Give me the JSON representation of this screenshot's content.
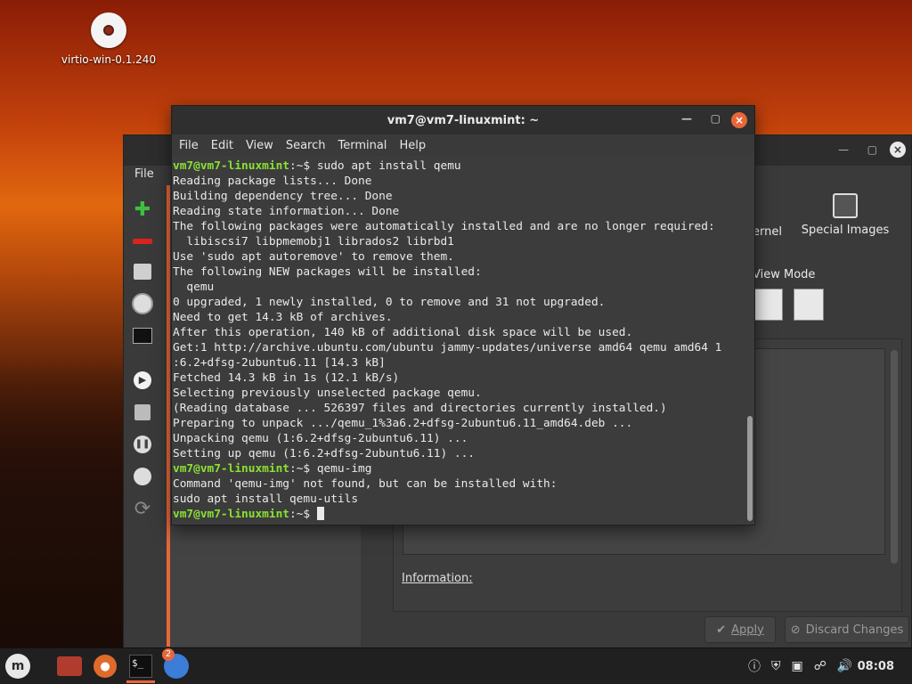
{
  "desktop": {
    "icon_label": "virtio-win-0.1.240"
  },
  "virt_window": {
    "menu_file": "File",
    "kernel_label": "ernel",
    "special_images_label": "Special Images",
    "view_mode_label": "View Mode",
    "information_label": "Information:",
    "apply_label": "Apply",
    "discard_label": "Discard Changes"
  },
  "terminal": {
    "title": "vm7@vm7-linuxmint: ~",
    "menu": [
      "File",
      "Edit",
      "View",
      "Search",
      "Terminal",
      "Help"
    ],
    "lines": [
      {
        "prompt": "vm7@vm7-linuxmint",
        "path": ":~$ ",
        "text": "sudo apt install qemu"
      },
      {
        "text": "Reading package lists... Done"
      },
      {
        "text": "Building dependency tree... Done"
      },
      {
        "text": "Reading state information... Done"
      },
      {
        "text": "The following packages were automatically installed and are no longer required:"
      },
      {
        "text": "  libiscsi7 libpmemobj1 librados2 librbd1"
      },
      {
        "text": "Use 'sudo apt autoremove' to remove them."
      },
      {
        "text": "The following NEW packages will be installed:"
      },
      {
        "text": "  qemu"
      },
      {
        "text": "0 upgraded, 1 newly installed, 0 to remove and 31 not upgraded."
      },
      {
        "text": "Need to get 14.3 kB of archives."
      },
      {
        "text": "After this operation, 140 kB of additional disk space will be used."
      },
      {
        "text": "Get:1 http://archive.ubuntu.com/ubuntu jammy-updates/universe amd64 qemu amd64 1"
      },
      {
        "text": ":6.2+dfsg-2ubuntu6.11 [14.3 kB]"
      },
      {
        "text": "Fetched 14.3 kB in 1s (12.1 kB/s)"
      },
      {
        "text": "Selecting previously unselected package qemu."
      },
      {
        "text": "(Reading database ... 526397 files and directories currently installed.)"
      },
      {
        "text": "Preparing to unpack .../qemu_1%3a6.2+dfsg-2ubuntu6.11_amd64.deb ..."
      },
      {
        "text": "Unpacking qemu (1:6.2+dfsg-2ubuntu6.11) ..."
      },
      {
        "text": "Setting up qemu (1:6.2+dfsg-2ubuntu6.11) ..."
      },
      {
        "prompt": "vm7@vm7-linuxmint",
        "path": ":~$ ",
        "text": "qemu-img"
      },
      {
        "text": "Command 'qemu-img' not found, but can be installed with:"
      },
      {
        "text": "sudo apt install qemu-utils"
      },
      {
        "prompt": "vm7@vm7-linuxmint",
        "path": ":~$ ",
        "text": "",
        "cursor": true
      }
    ]
  },
  "taskbar": {
    "badge_count": "2",
    "clock": "08:08",
    "accent": "#e8663a"
  }
}
